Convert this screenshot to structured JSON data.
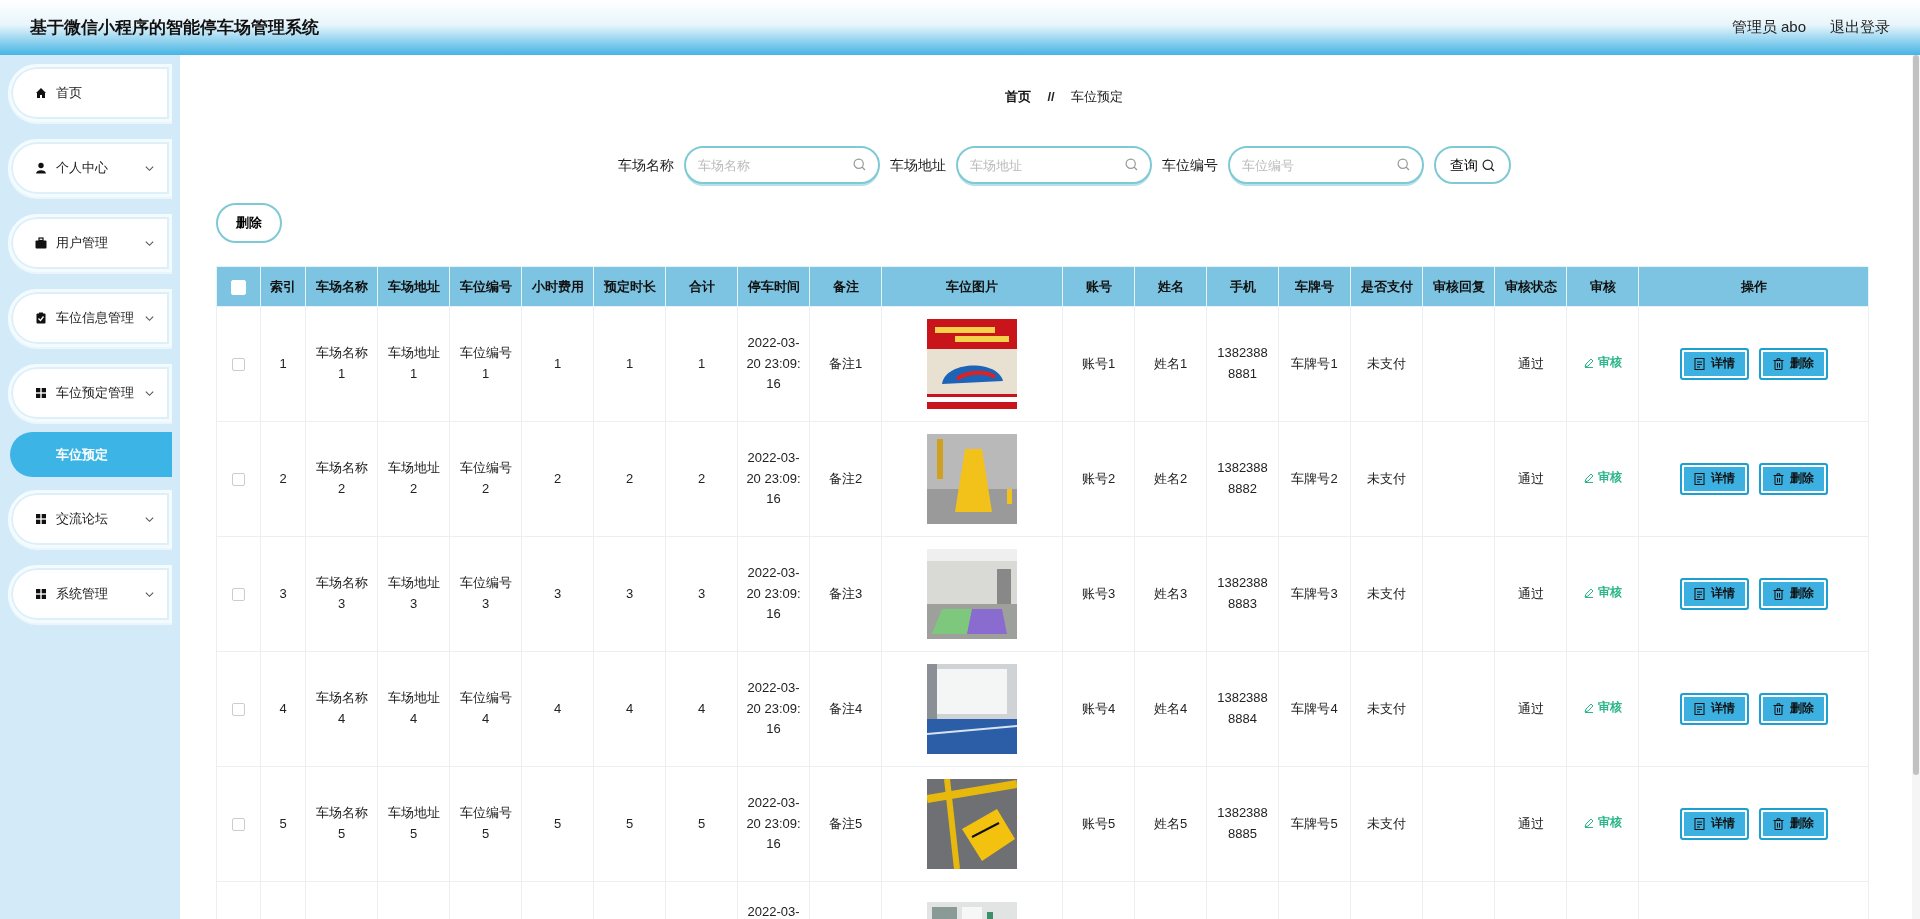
{
  "header": {
    "title": "基于微信小程序的智能停车场管理系统",
    "user": "管理员 abo",
    "logout": "退出登录"
  },
  "sidebar": {
    "items": [
      {
        "label": "首页",
        "expandable": false
      },
      {
        "label": "个人中心",
        "expandable": true
      },
      {
        "label": "用户管理",
        "expandable": true
      },
      {
        "label": "车位信息管理",
        "expandable": true
      },
      {
        "label": "车位预定管理",
        "expandable": true,
        "children": [
          {
            "label": "车位预定",
            "selected": true
          }
        ]
      },
      {
        "label": "交流论坛",
        "expandable": true
      },
      {
        "label": "系统管理",
        "expandable": true
      }
    ]
  },
  "breadcrumb": {
    "home": "首页",
    "separator": "//",
    "current": "车位预定"
  },
  "search": {
    "fields": [
      {
        "label": "车场名称",
        "placeholder": "车场名称"
      },
      {
        "label": "车场地址",
        "placeholder": "车场地址"
      },
      {
        "label": "车位编号",
        "placeholder": "车位编号"
      }
    ],
    "button": "查询"
  },
  "delete_button": "删除",
  "table": {
    "select_all_checked": false,
    "columns": [
      "索引",
      "车场名称",
      "车场地址",
      "车位编号",
      "小时费用",
      "预定时长",
      "合计",
      "停车时间",
      "备注",
      "车位图片",
      "账号",
      "姓名",
      "手机",
      "车牌号",
      "是否支付",
      "审核回复",
      "审核状态",
      "审核",
      "操作"
    ],
    "rows": [
      {
        "selected": false,
        "index": "1",
        "lot_name": "车场名称1",
        "lot_address": "车场地址1",
        "space_no": "车位编号1",
        "hourly_fee": "1",
        "duration": "1",
        "total": "1",
        "time": "2022-03-20 23:09:16",
        "note": "备注1",
        "account": "账号1",
        "name": "姓名1",
        "phone": "13823888881",
        "plate": "车牌号1",
        "paid": "未支付",
        "status": "通过",
        "review": "审核",
        "actions": [
          "详情",
          "删除"
        ]
      },
      {
        "selected": false,
        "index": "2",
        "lot_name": "车场名称2",
        "lot_address": "车场地址2",
        "space_no": "车位编号2",
        "hourly_fee": "2",
        "duration": "2",
        "total": "2",
        "time": "2022-03-20 23:09:16",
        "note": "备注2",
        "account": "账号2",
        "name": "姓名2",
        "phone": "13823888882",
        "plate": "车牌号2",
        "paid": "未支付",
        "status": "通过",
        "review": "审核",
        "actions": [
          "详情",
          "删除"
        ]
      },
      {
        "selected": false,
        "index": "3",
        "lot_name": "车场名称3",
        "lot_address": "车场地址3",
        "space_no": "车位编号3",
        "hourly_fee": "3",
        "duration": "3",
        "total": "3",
        "time": "2022-03-20 23:09:16",
        "note": "备注3",
        "account": "账号3",
        "name": "姓名3",
        "phone": "13823888883",
        "plate": "车牌号3",
        "paid": "未支付",
        "status": "通过",
        "review": "审核",
        "actions": [
          "详情",
          "删除"
        ]
      },
      {
        "selected": false,
        "index": "4",
        "lot_name": "车场名称4",
        "lot_address": "车场地址4",
        "space_no": "车位编号4",
        "hourly_fee": "4",
        "duration": "4",
        "total": "4",
        "time": "2022-03-20 23:09:16",
        "note": "备注4",
        "account": "账号4",
        "name": "姓名4",
        "phone": "13823888884",
        "plate": "车牌号4",
        "paid": "未支付",
        "status": "通过",
        "review": "审核",
        "actions": [
          "详情",
          "删除"
        ]
      },
      {
        "selected": false,
        "index": "5",
        "lot_name": "车场名称5",
        "lot_address": "车场地址5",
        "space_no": "车位编号5",
        "hourly_fee": "5",
        "duration": "5",
        "total": "5",
        "time": "2022-03-20 23:09:16",
        "note": "备注5",
        "account": "账号5",
        "name": "姓名5",
        "phone": "13823888885",
        "plate": "车牌号5",
        "paid": "未支付",
        "status": "通过",
        "review": "审核",
        "actions": [
          "详情",
          "删除"
        ]
      },
      {
        "time": "2022-03-"
      }
    ]
  }
}
